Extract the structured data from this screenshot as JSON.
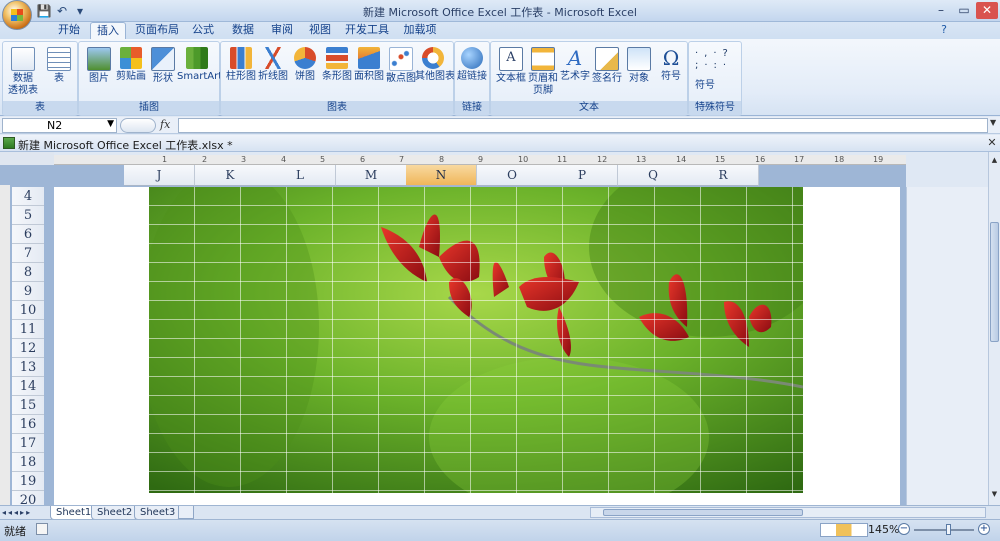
{
  "window": {
    "title": "新建 Microsoft Office Excel 工作表 - Microsoft Excel",
    "min": "–",
    "max": "▭",
    "close": "✕"
  },
  "quick_access": [
    "💾",
    "↶",
    "▾"
  ],
  "tabs": [
    {
      "label": "开始"
    },
    {
      "label": "插入",
      "active": true
    },
    {
      "label": "页面布局"
    },
    {
      "label": "公式"
    },
    {
      "label": "数据"
    },
    {
      "label": "审阅"
    },
    {
      "label": "视图"
    },
    {
      "label": "开发工具"
    },
    {
      "label": "加载项"
    }
  ],
  "ribbon": {
    "groups": {
      "table": {
        "label": "表",
        "buttons": [
          {
            "label": "数据\n透视表",
            "icon": "pivot-table-icon"
          },
          {
            "label": "表",
            "icon": "table-icon"
          }
        ]
      },
      "illustrations": {
        "label": "插图",
        "buttons": [
          {
            "label": "图片",
            "icon": "picture-icon"
          },
          {
            "label": "剪贴画",
            "icon": "clipart-icon"
          },
          {
            "label": "形状",
            "icon": "shapes-icon"
          },
          {
            "label": "SmartArt",
            "icon": "smartart-icon"
          }
        ]
      },
      "charts": {
        "label": "图表",
        "buttons": [
          {
            "label": "柱形图",
            "icon": "column-chart-icon"
          },
          {
            "label": "折线图",
            "icon": "line-chart-icon"
          },
          {
            "label": "饼图",
            "icon": "pie-chart-icon"
          },
          {
            "label": "条形图",
            "icon": "bar-chart-icon"
          },
          {
            "label": "面积图",
            "icon": "area-chart-icon"
          },
          {
            "label": "散点图",
            "icon": "scatter-chart-icon"
          },
          {
            "label": "其他图表",
            "icon": "other-charts-icon"
          }
        ]
      },
      "links": {
        "label": "链接",
        "buttons": [
          {
            "label": "超链接",
            "icon": "hyperlink-icon"
          }
        ]
      },
      "text": {
        "label": "文本",
        "buttons": [
          {
            "label": "文本框",
            "icon": "textbox-icon"
          },
          {
            "label": "页眉和\n页脚",
            "icon": "header-footer-icon"
          },
          {
            "label": "艺术字",
            "icon": "wordart-icon"
          },
          {
            "label": "签名行",
            "icon": "signature-line-icon"
          },
          {
            "label": "对象",
            "icon": "object-icon"
          },
          {
            "label": "符号",
            "icon": "symbol-icon"
          }
        ]
      },
      "special": {
        "label": "特殊符号",
        "buttons": [
          {
            "label": "符号",
            "icon": "special-symbol-icon"
          }
        ]
      }
    }
  },
  "formula_bar": {
    "name_box": "N2",
    "fx": "fx",
    "value": ""
  },
  "workbook": {
    "title": "新建 Microsoft Office Excel 工作表.xlsx *"
  },
  "ruler_numbers": [
    "1",
    "2",
    "3",
    "4",
    "5",
    "6",
    "7",
    "8",
    "9",
    "10",
    "11",
    "12",
    "13",
    "14",
    "15",
    "16",
    "17",
    "18",
    "19"
  ],
  "columns": [
    {
      "label": "J"
    },
    {
      "label": "K"
    },
    {
      "label": "L"
    },
    {
      "label": "M"
    },
    {
      "label": "N",
      "selected": true
    },
    {
      "label": "O"
    },
    {
      "label": "P"
    },
    {
      "label": "Q"
    },
    {
      "label": "R"
    }
  ],
  "rows": [
    "4",
    "5",
    "6",
    "7",
    "8",
    "9",
    "10",
    "11",
    "12",
    "13",
    "14",
    "15",
    "16",
    "17",
    "18",
    "19",
    "20"
  ],
  "sheets": [
    "Sheet1",
    "Sheet2",
    "Sheet3"
  ],
  "status": {
    "mode": "就绪",
    "zoom": "145%"
  },
  "colors": {
    "accent": "#15428b",
    "selected_col": "#f0b65a",
    "photo_green": "#5a9a1e",
    "leaf_red": "#c41c1c"
  }
}
